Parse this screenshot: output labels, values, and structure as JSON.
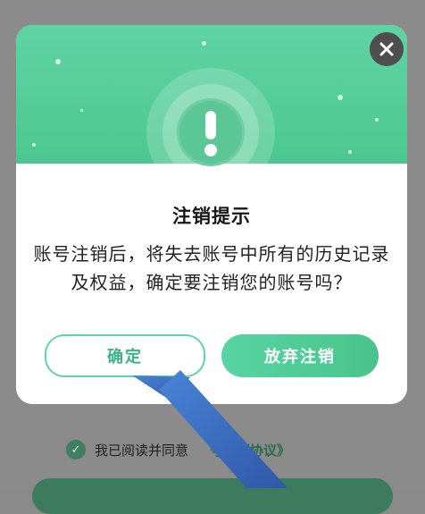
{
  "dialog": {
    "title": "注销提示",
    "message": "账号注销后，将失去账号中所有的历史记录及权益，确定要注销您的账号吗？",
    "confirm_label": "确定",
    "cancel_label": "放弃注销",
    "close_icon": "close-icon",
    "alert_icon": "exclamation-icon"
  },
  "agreement": {
    "text": "我已阅读并同意",
    "link_text": "号注销协议》"
  },
  "colors": {
    "accent_green": "#4cc88f",
    "close_bg": "#4f4f4f",
    "overlay": "#8b8b8b",
    "arrow_blue": "#3d6fc4"
  }
}
